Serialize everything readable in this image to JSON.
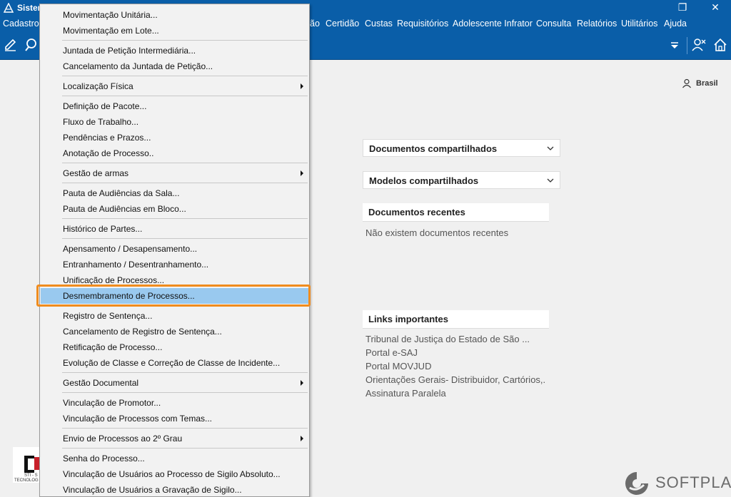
{
  "window": {
    "title": "Sistem",
    "restore_glyph": "❐",
    "close_glyph": "✕"
  },
  "menubar": {
    "items": [
      {
        "label": "Cadastro"
      },
      {
        "label": "ão"
      },
      {
        "label": "Certidão"
      },
      {
        "label": "Custas"
      },
      {
        "label": "Requisitórios"
      },
      {
        "label": "Adolescente Infrator"
      },
      {
        "label": "Consulta"
      },
      {
        "label": "Relatórios"
      },
      {
        "label": "Utilitários"
      },
      {
        "label": "Ajuda"
      }
    ]
  },
  "toolbar": {
    "icons": [
      "edit-icon",
      "search-document-icon",
      "dropdown-arrow-icon",
      "users-icon",
      "home-icon"
    ]
  },
  "dropdown": {
    "items": [
      {
        "label": "Movimentação Unitária...",
        "submenu": false
      },
      {
        "label": "Movimentação em Lote...",
        "submenu": false
      },
      {
        "label": "Juntada de Petição Intermediária...",
        "submenu": false
      },
      {
        "label": "Cancelamento da Juntada de Petição...",
        "submenu": false
      },
      {
        "label": "Localização Física",
        "submenu": true
      },
      {
        "label": "Definição de Pacote...",
        "submenu": false
      },
      {
        "label": "Fluxo de Trabalho...",
        "submenu": false
      },
      {
        "label": "Pendências e Prazos...",
        "submenu": false
      },
      {
        "label": "Anotação de Processo..",
        "submenu": false
      },
      {
        "label": "Gestão de armas",
        "submenu": true
      },
      {
        "label": "Pauta de Audiências da Sala...",
        "submenu": false
      },
      {
        "label": "Pauta de Audiências em Bloco...",
        "submenu": false
      },
      {
        "label": "Histórico de Partes...",
        "submenu": false
      },
      {
        "label": "Apensamento / Desapensamento...",
        "submenu": false
      },
      {
        "label": "Entranhamento / Desentranhamento...",
        "submenu": false
      },
      {
        "label": "Unificação de Processos...",
        "submenu": false
      },
      {
        "label": "Desmembramento de Processos...",
        "submenu": false,
        "highlighted": true
      },
      {
        "label": "Registro de Sentença...",
        "submenu": false
      },
      {
        "label": "Cancelamento de Registro de Sentença...",
        "submenu": false
      },
      {
        "label": "Retificação de Processo...",
        "submenu": false
      },
      {
        "label": "Evolução de Classe e Correção de Classe de Incidente...",
        "submenu": false
      },
      {
        "label": "Gestão Documental",
        "submenu": true
      },
      {
        "label": "Vinculação de Promotor...",
        "submenu": false
      },
      {
        "label": "Vinculação de Processos com Temas...",
        "submenu": false
      },
      {
        "label": "Envio de Processos ao 2º Grau",
        "submenu": true
      },
      {
        "label": "Senha do Processo...",
        "submenu": false
      },
      {
        "label": "Vinculação de Usuários ao Processo de Sigilo Absoluto...",
        "submenu": false
      },
      {
        "label": "Vinculação de Usuários a Gravação de Sigilo...",
        "submenu": false
      }
    ]
  },
  "main": {
    "region_label": "Brasil",
    "shared_documents": "Documentos compartilhados",
    "shared_models": "Modelos compartilhados",
    "recent_documents": "Documentos recentes",
    "no_recent": "Não existem documentos recentes",
    "important_links": "Links importantes",
    "links": [
      "Tribunal de Justiça do Estado de São ...",
      "Portal e-SAJ",
      "Portal MOVJUD",
      "Orientações Gerais- Distribuidor, Cartórios,.",
      "Assinatura Paralela"
    ]
  },
  "footer": {
    "logo_line1": "STI - S",
    "logo_line2": "TECNOLOG",
    "brand": "SOFTPLAN"
  },
  "colors": {
    "titlebar": "#0a5ea8",
    "highlight": "#99c9ef",
    "callout": "#f08c1e"
  }
}
